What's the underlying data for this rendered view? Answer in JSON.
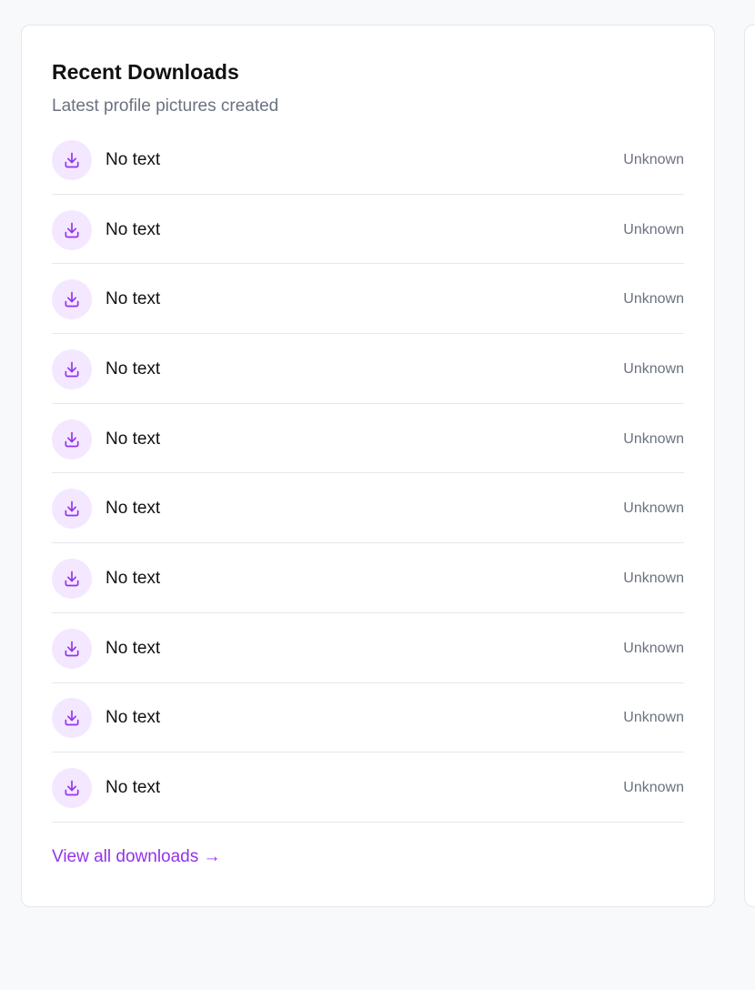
{
  "card": {
    "title": "Recent Downloads",
    "subtitle": "Latest profile pictures created",
    "view_all_label": "View all downloads →"
  },
  "downloads": [
    {
      "label": "No text",
      "meta": "Unknown",
      "icon": "download-icon"
    },
    {
      "label": "No text",
      "meta": "Unknown",
      "icon": "download-icon"
    },
    {
      "label": "No text",
      "meta": "Unknown",
      "icon": "download-icon"
    },
    {
      "label": "No text",
      "meta": "Unknown",
      "icon": "download-icon"
    },
    {
      "label": "No text",
      "meta": "Unknown",
      "icon": "download-icon"
    },
    {
      "label": "No text",
      "meta": "Unknown",
      "icon": "download-icon"
    },
    {
      "label": "No text",
      "meta": "Unknown",
      "icon": "download-icon"
    },
    {
      "label": "No text",
      "meta": "Unknown",
      "icon": "download-icon"
    },
    {
      "label": "No text",
      "meta": "Unknown",
      "icon": "download-icon"
    },
    {
      "label": "No text",
      "meta": "Unknown",
      "icon": "download-icon"
    }
  ],
  "colors": {
    "accent": "#9333ea",
    "icon_bg": "#f3e8ff",
    "muted": "#6b7280",
    "border": "#e5e7eb"
  }
}
